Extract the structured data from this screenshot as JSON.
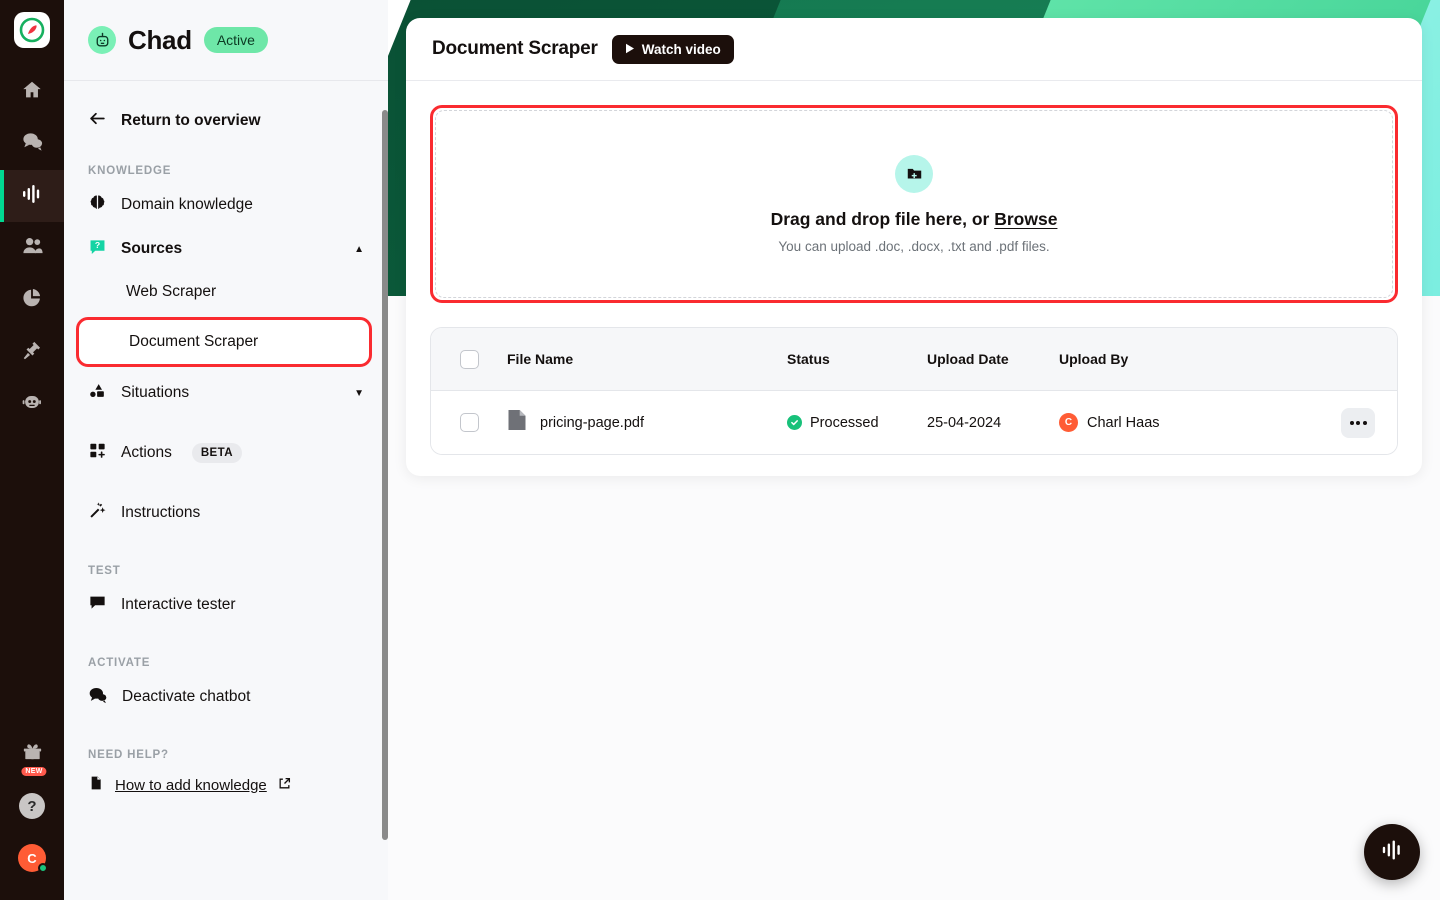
{
  "rail": {
    "logo_icon": "compass-logo-icon",
    "items": [
      {
        "icon": "home-icon",
        "name": "rail-item-home",
        "active": false
      },
      {
        "icon": "chat-bubbles-icon",
        "name": "rail-item-conversations",
        "active": false
      },
      {
        "icon": "waveform-icon",
        "name": "rail-item-chatbots",
        "active": true
      },
      {
        "icon": "users-icon",
        "name": "rail-item-contacts",
        "active": false
      },
      {
        "icon": "pie-chart-icon",
        "name": "rail-item-analytics",
        "active": false
      },
      {
        "icon": "plug-icon",
        "name": "rail-item-integrations",
        "active": false
      },
      {
        "icon": "robot-icon",
        "name": "rail-item-bots",
        "active": false
      }
    ],
    "gift_badge_label": "NEW",
    "help_label": "?",
    "avatar_initial": "C"
  },
  "sidebar": {
    "bot_name": "Chad",
    "bot_icon": "robot-head-icon",
    "status_label": "Active",
    "return_label": "Return to overview",
    "sections": [
      {
        "title": "KNOWLEDGE",
        "items": [
          {
            "label": "Domain knowledge",
            "icon": "brain-icon",
            "caret": null
          },
          {
            "label": "Sources",
            "icon": "question-bubble-icon",
            "caret": "▲",
            "children": [
              {
                "label": "Web Scraper",
                "selected": false
              },
              {
                "label": "Document Scraper",
                "selected": true
              }
            ]
          },
          {
            "label": "Situations",
            "icon": "shapes-icon",
            "caret": "▼"
          },
          {
            "label": "Actions",
            "icon": "grid-plus-icon",
            "badge": "BETA"
          },
          {
            "label": "Instructions",
            "icon": "magic-wand-icon",
            "caret": null
          }
        ]
      },
      {
        "title": "TEST",
        "items": [
          {
            "label": "Interactive tester",
            "icon": "speech-bubble-icon",
            "caret": null
          }
        ]
      },
      {
        "title": "ACTIVATE",
        "items": [
          {
            "label": "Deactivate chatbot",
            "icon": "chat-dots-icon",
            "caret": null
          }
        ]
      }
    ],
    "help_section_title": "NEED HELP?",
    "help_link_label": "How to add knowledge",
    "help_link_icon": "external-link-icon"
  },
  "main": {
    "title": "Document Scraper",
    "watch_video_label": "Watch video",
    "watch_video_icon": "play-icon",
    "dropzone": {
      "icon": "folder-plus-icon",
      "title_before": "Drag and drop file here, or ",
      "browse_label": "Browse",
      "subtitle": "You can upload .doc, .docx, .txt and .pdf files."
    },
    "table": {
      "columns": [
        "File Name",
        "Status",
        "Upload Date",
        "Upload By"
      ],
      "rows": [
        {
          "file_name": "pricing-page.pdf",
          "file_icon": "file-icon",
          "status": "Processed",
          "status_icon": "check-circle-icon",
          "upload_date": "25-04-2024",
          "upload_by": "Charl Haas",
          "upload_by_initial": "C",
          "actions_icon": "kebab-menu-icon"
        }
      ]
    }
  },
  "fab": {
    "icon": "waveform-icon"
  },
  "colors": {
    "accent_green": "#00d991",
    "highlight_red": "#fa2b30",
    "dark": "#1c0f0b",
    "status_green": "#18c17a",
    "avatar_orange": "#ff5c35",
    "mint": "#7af0b6"
  }
}
